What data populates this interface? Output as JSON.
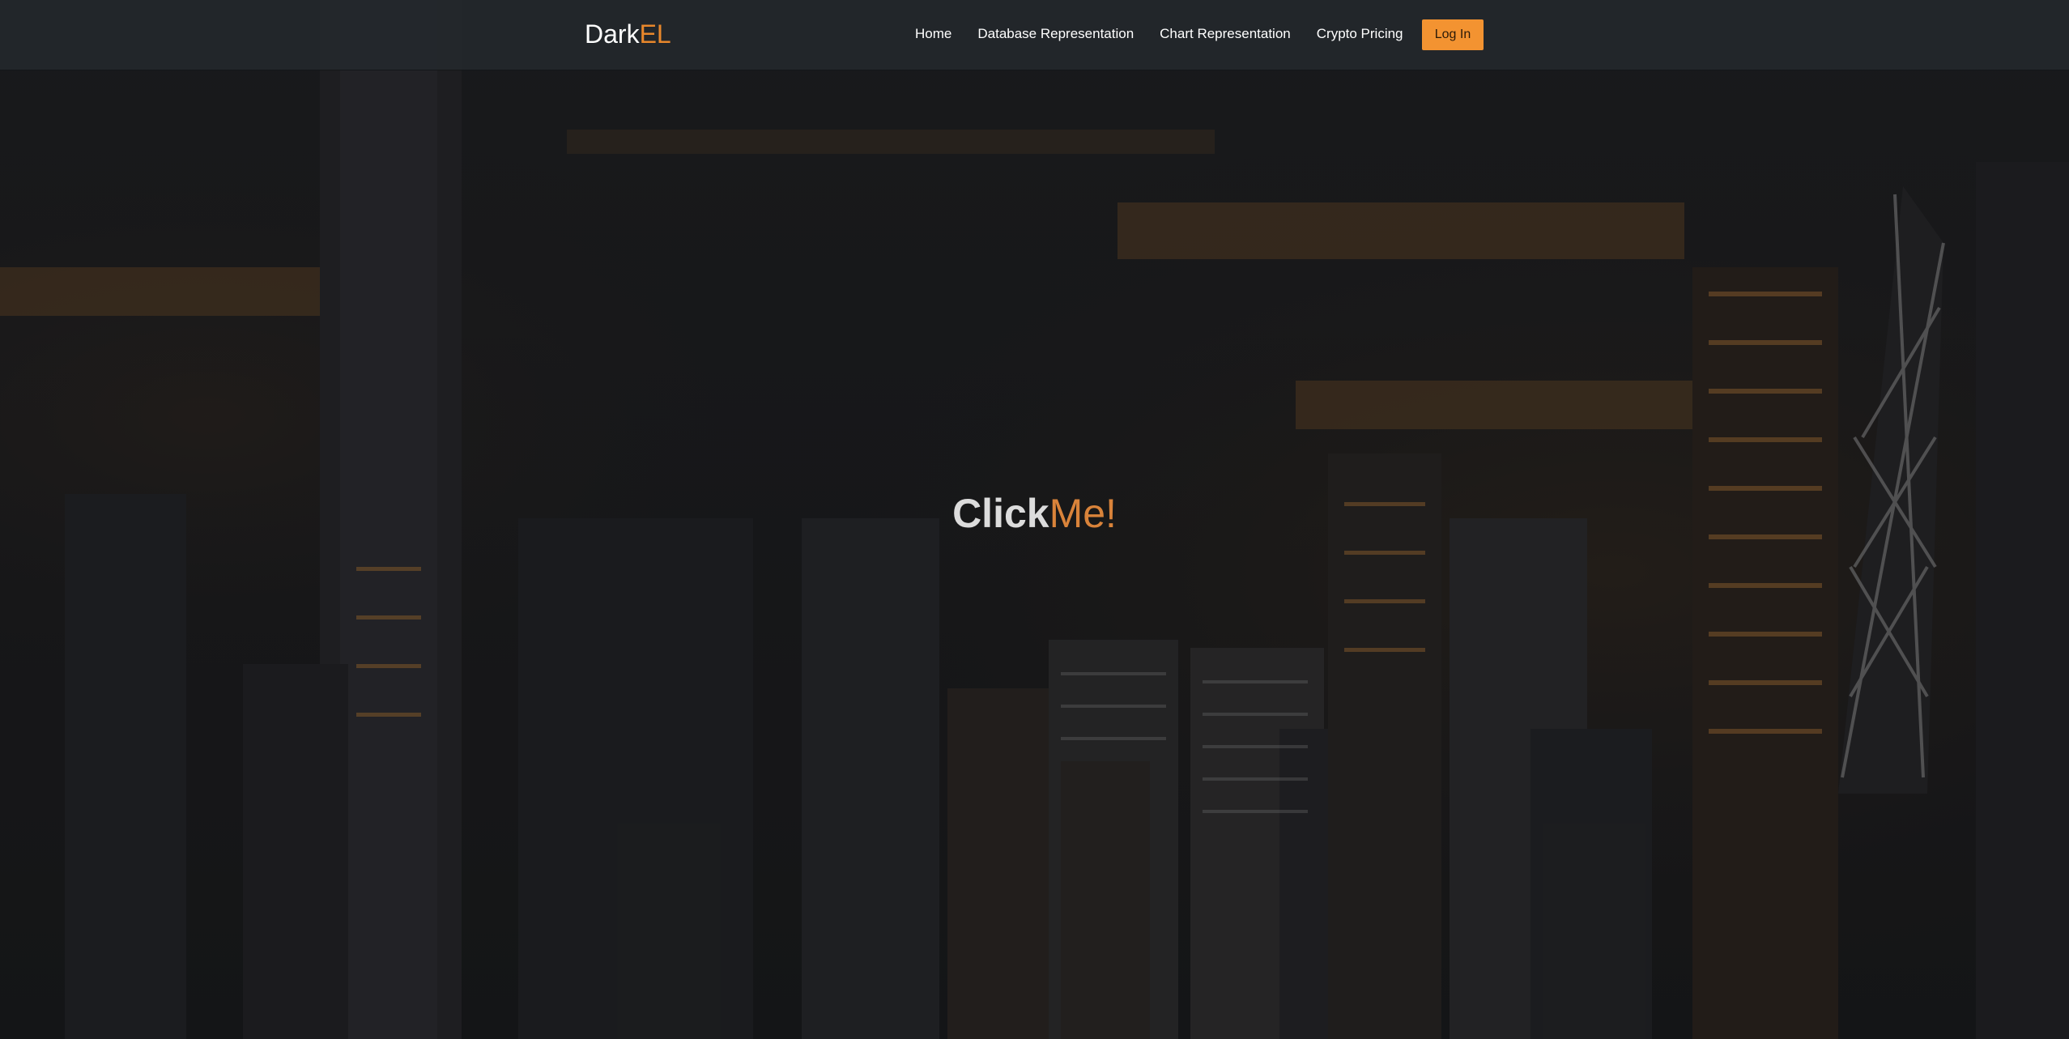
{
  "brand": {
    "part1": "Dark",
    "part2": "EL"
  },
  "nav": {
    "items": [
      {
        "label": "Home"
      },
      {
        "label": "Database Representation"
      },
      {
        "label": "Chart Representation"
      },
      {
        "label": "Crypto Pricing"
      }
    ],
    "login_label": "Log In"
  },
  "hero": {
    "part1": "Click",
    "part2": "Me!"
  },
  "colors": {
    "accent": "#f39331",
    "brand_accent": "#e8872b",
    "navbar_bg": "#24282c",
    "background": "#17181a"
  }
}
